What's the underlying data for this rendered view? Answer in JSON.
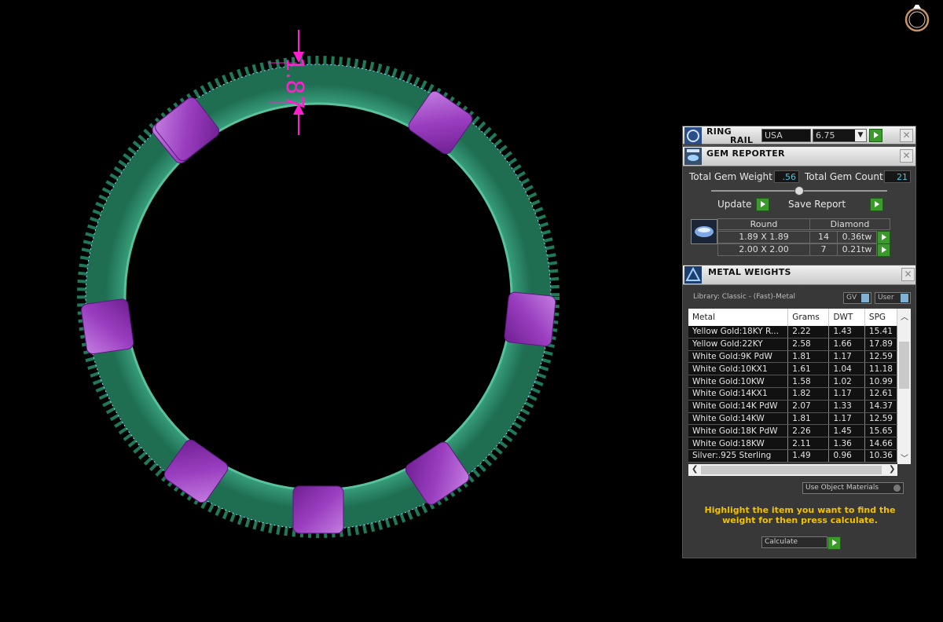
{
  "viewport": {
    "measurement": "1.87",
    "colors": {
      "band": "#2d8a6a",
      "gem": "#9a3ec0",
      "dimension": "#ff1fd0"
    }
  },
  "ring_rail": {
    "title_line1": "RING",
    "title_line2": "RAIL",
    "region": "USA",
    "size": "6.75"
  },
  "gem_reporter": {
    "title": "GEM REPORTER",
    "total_weight_label": "Total Gem Weight",
    "total_weight_value": ".56",
    "total_count_label": "Total Gem Count",
    "total_count_value": "21",
    "update_label": "Update",
    "save_report_label": "Save Report",
    "table": {
      "shape": "Round",
      "material": "Diamond",
      "rows": [
        {
          "size": "1.89 X 1.89",
          "count": "14",
          "weight": "0.36tw"
        },
        {
          "size": "2.00 X 2.00",
          "count": "7",
          "weight": "0.21tw"
        }
      ]
    }
  },
  "metal_weights": {
    "title": "METAL WEIGHTS",
    "library": "Library: Classic - (Fast)-Metal",
    "gv_label": "GV",
    "user_label": "User",
    "columns": [
      "Metal",
      "Grams",
      "DWT",
      "SPG"
    ],
    "rows": [
      {
        "metal": "Yellow Gold:18KY R...",
        "grams": "2.22",
        "dwt": "1.43",
        "spg": "15.41"
      },
      {
        "metal": "Yellow Gold:22KY",
        "grams": "2.58",
        "dwt": "1.66",
        "spg": "17.89"
      },
      {
        "metal": "White Gold:9K PdW",
        "grams": "1.81",
        "dwt": "1.17",
        "spg": "12.59"
      },
      {
        "metal": "White Gold:10KX1",
        "grams": "1.61",
        "dwt": "1.04",
        "spg": "11.18"
      },
      {
        "metal": "White Gold:10KW",
        "grams": "1.58",
        "dwt": "1.02",
        "spg": "10.99"
      },
      {
        "metal": "White Gold:14KX1",
        "grams": "1.82",
        "dwt": "1.17",
        "spg": "12.61"
      },
      {
        "metal": "White Gold:14K PdW",
        "grams": "2.07",
        "dwt": "1.33",
        "spg": "14.37"
      },
      {
        "metal": "White Gold:14KW",
        "grams": "1.81",
        "dwt": "1.17",
        "spg": "12.59"
      },
      {
        "metal": "White Gold:18K PdW",
        "grams": "2.26",
        "dwt": "1.45",
        "spg": "15.65"
      },
      {
        "metal": "White Gold:18KW",
        "grams": "2.11",
        "dwt": "1.36",
        "spg": "14.66"
      },
      {
        "metal": "Silver:.925 Sterling",
        "grams": "1.49",
        "dwt": "0.96",
        "spg": "10.36"
      }
    ],
    "use_object_materials": "Use Object Materials",
    "hint": "Highlight the item you want to find the weight for then press calculate.",
    "hint_color": "#f2c200",
    "calculate_label": "Calculate"
  }
}
